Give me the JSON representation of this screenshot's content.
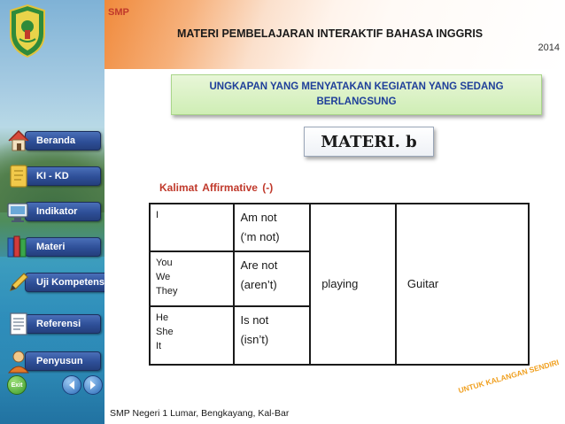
{
  "header": {
    "level": "SMP",
    "title": "MATERI PEMBELAJARAN INTERAKTIF BAHASA INGGRIS",
    "year": "2014"
  },
  "topic": {
    "line1": "UNGKAPAN YANG MENYATAKAN KEGIATAN  YANG SEDANG",
    "line2": "BERLANGSUNG"
  },
  "section_badge": "MATERI. b",
  "subtitle": "Kalimat  Affirmative   (-)",
  "sidebar": {
    "items": [
      {
        "label": "Beranda",
        "icon": "house-icon"
      },
      {
        "label": "KI - KD",
        "icon": "notebook-icon"
      },
      {
        "label": "Indikator",
        "icon": "computer-icon"
      },
      {
        "label": "Materi",
        "icon": "books-icon"
      },
      {
        "label": "Uji Kompetensi",
        "icon": "pencil-icon"
      },
      {
        "label": "Referensi",
        "icon": "document-icon"
      },
      {
        "label": "Penyusun",
        "icon": "person-icon"
      }
    ],
    "nav": {
      "exit": "Exit"
    }
  },
  "table": {
    "rows": [
      {
        "subjects": [
          "I"
        ],
        "aux": [
          "Am not",
          "(‘m not)"
        ]
      },
      {
        "subjects": [
          "You",
          "We",
          "They"
        ],
        "aux": [
          "Are not",
          "(aren’t)"
        ]
      },
      {
        "subjects": [
          "He",
          "She",
          "It"
        ],
        "aux": [
          "Is not",
          "(isn’t)"
        ]
      }
    ],
    "verb": "playing",
    "object": "Guitar"
  },
  "footer": {
    "school": "SMP Negeri 1 Lumar, Bengkayang, Kal-Bar",
    "sash": "UNTUK KALANGAN SENDIRI"
  },
  "colors": {
    "menu_pill": "#2e4f97",
    "topic_text": "#1f3f9a",
    "subtitle": "#c0392b",
    "header_accent": "#f08a3c"
  }
}
